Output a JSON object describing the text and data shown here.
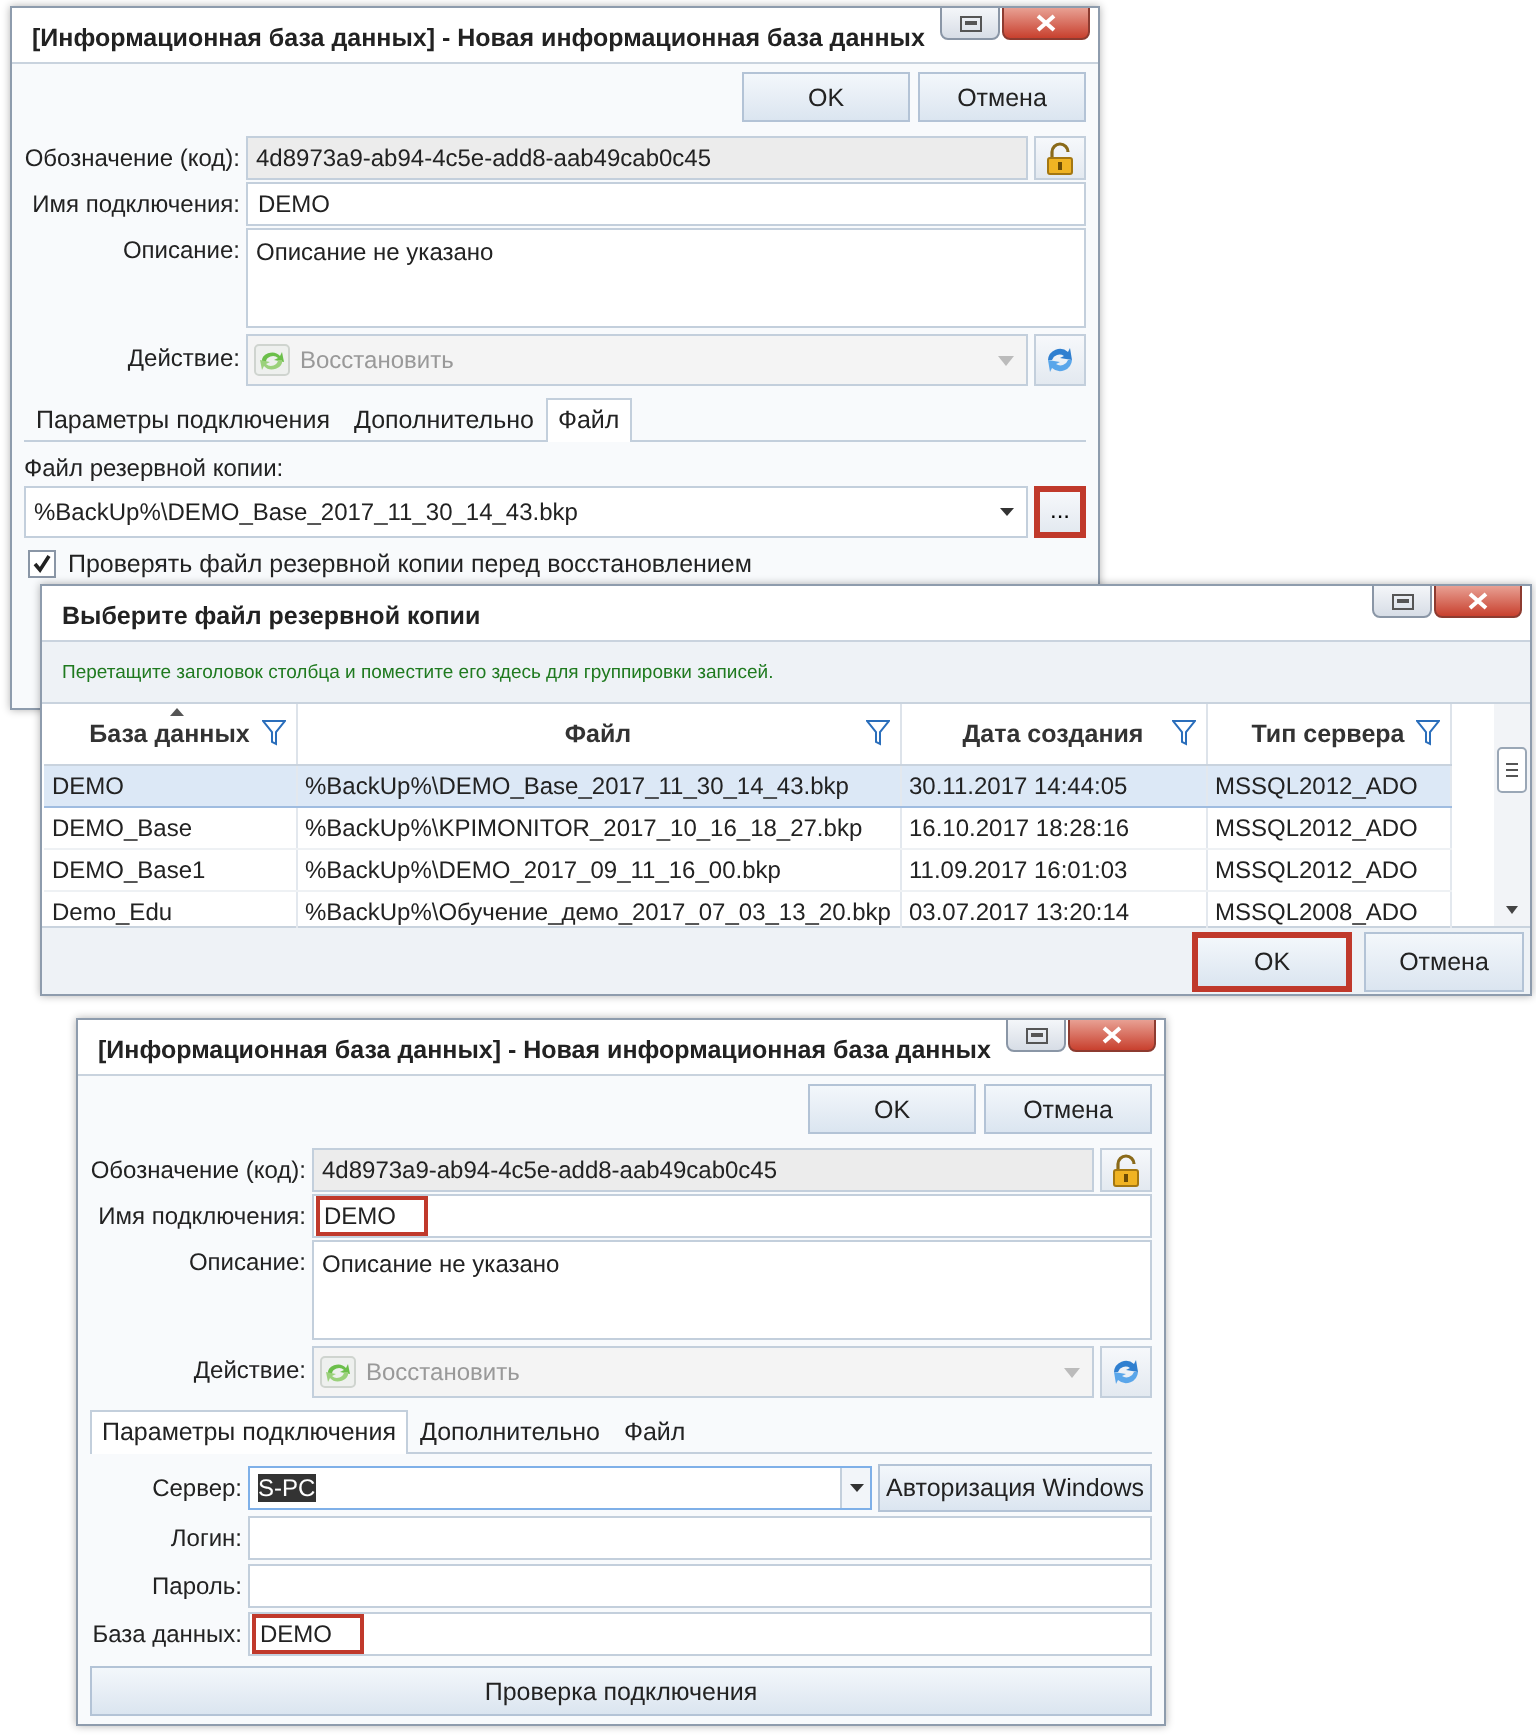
{
  "windows": [
    {
      "kind": "form",
      "title": "[Информационная база данных] - Новая информационная база данных",
      "buttons": [
        {
          "label": "OK",
          "highlighted": false
        },
        {
          "label": "Отмена",
          "highlighted": false
        }
      ],
      "fields": [
        {
          "kind": "locked",
          "label": "Обозначение (код):",
          "value": "4d8973a9-ab94-4c5e-add8-aab49cab0c45"
        },
        {
          "kind": "text",
          "label": "Имя подключения:",
          "value": "DEMO",
          "highlighted": false
        },
        {
          "kind": "memo",
          "label": "Описание:",
          "value": "Описание не указано"
        },
        {
          "kind": "action",
          "label": "Действие:",
          "value": "Восстановить"
        }
      ],
      "tabs": [
        {
          "label": "Параметры подключения",
          "selected": false
        },
        {
          "label": "Дополнительно",
          "selected": false
        },
        {
          "label": "Файл",
          "selected": true
        }
      ],
      "tab_content": {
        "kind": "file",
        "label": "Файл резервной копии:",
        "value": "%BackUp%\\DEMO_Base_2017_11_30_14_43.bkp",
        "browse_button": {
          "label": "...",
          "highlighted": true
        },
        "checkbox": {
          "label": "Проверять файл резервной копии перед восстановлением",
          "checked": true
        }
      }
    },
    {
      "kind": "file_dialog",
      "title": "Выберите файл резервной копии",
      "group_hint": "Перетащите заголовок столбца и поместите его здесь для группировки записей.",
      "columns": [
        {
          "label": "База данных",
          "sorted": true
        },
        {
          "label": "Файл",
          "sorted": false
        },
        {
          "label": "Дата создания",
          "sorted": false
        },
        {
          "label": "Тип сервера",
          "sorted": false
        }
      ],
      "rows": [
        {
          "selected": true,
          "cells": [
            "DEMO",
            "%BackUp%\\DEMO_Base_2017_11_30_14_43.bkp",
            "30.11.2017 14:44:05",
            "MSSQL2012_ADO"
          ]
        },
        {
          "selected": false,
          "cells": [
            "DEMO_Base",
            "%BackUp%\\KPIMONITOR_2017_10_16_18_27.bkp",
            "16.10.2017 18:28:16",
            "MSSQL2012_ADO"
          ]
        },
        {
          "selected": false,
          "cells": [
            "DEMO_Base1",
            "%BackUp%\\DEMO_2017_09_11_16_00.bkp",
            "11.09.2017 16:01:03",
            "MSSQL2012_ADO"
          ]
        },
        {
          "selected": false,
          "cells": [
            "Demo_Edu",
            "%BackUp%\\Обучение_демо_2017_07_03_13_20.bkp",
            "03.07.2017 13:20:14",
            "MSSQL2008_ADO"
          ]
        }
      ],
      "buttons": [
        {
          "label": "OK",
          "highlighted": true
        },
        {
          "label": "Отмена",
          "highlighted": false
        }
      ]
    },
    {
      "kind": "form",
      "title": "[Информационная база данных] - Новая информационная база данных",
      "buttons": [
        {
          "label": "OK",
          "highlighted": false
        },
        {
          "label": "Отмена",
          "highlighted": false
        }
      ],
      "fields": [
        {
          "kind": "locked",
          "label": "Обозначение (код):",
          "value": "4d8973a9-ab94-4c5e-add8-aab49cab0c45"
        },
        {
          "kind": "text",
          "label": "Имя подключения:",
          "value": "DEMO",
          "highlighted": true
        },
        {
          "kind": "memo",
          "label": "Описание:",
          "value": "Описание не указано"
        },
        {
          "kind": "action",
          "label": "Действие:",
          "value": "Восстановить"
        }
      ],
      "tabs": [
        {
          "label": "Параметры подключения",
          "selected": true
        },
        {
          "label": "Дополнительно",
          "selected": false
        },
        {
          "label": "Файл",
          "selected": false
        }
      ],
      "tab_content": {
        "kind": "connection",
        "fields": [
          {
            "kind": "combo",
            "label": "Сервер:",
            "value": "S-PC",
            "value_selected": true,
            "button": "Авторизация Windows"
          },
          {
            "kind": "text",
            "label": "Логин:"
          },
          {
            "kind": "text",
            "label": "Пароль:"
          },
          {
            "kind": "text",
            "label": "База данных:",
            "value": "DEMO",
            "highlighted": true
          }
        ],
        "check_button": "Проверка подключения"
      }
    }
  ]
}
